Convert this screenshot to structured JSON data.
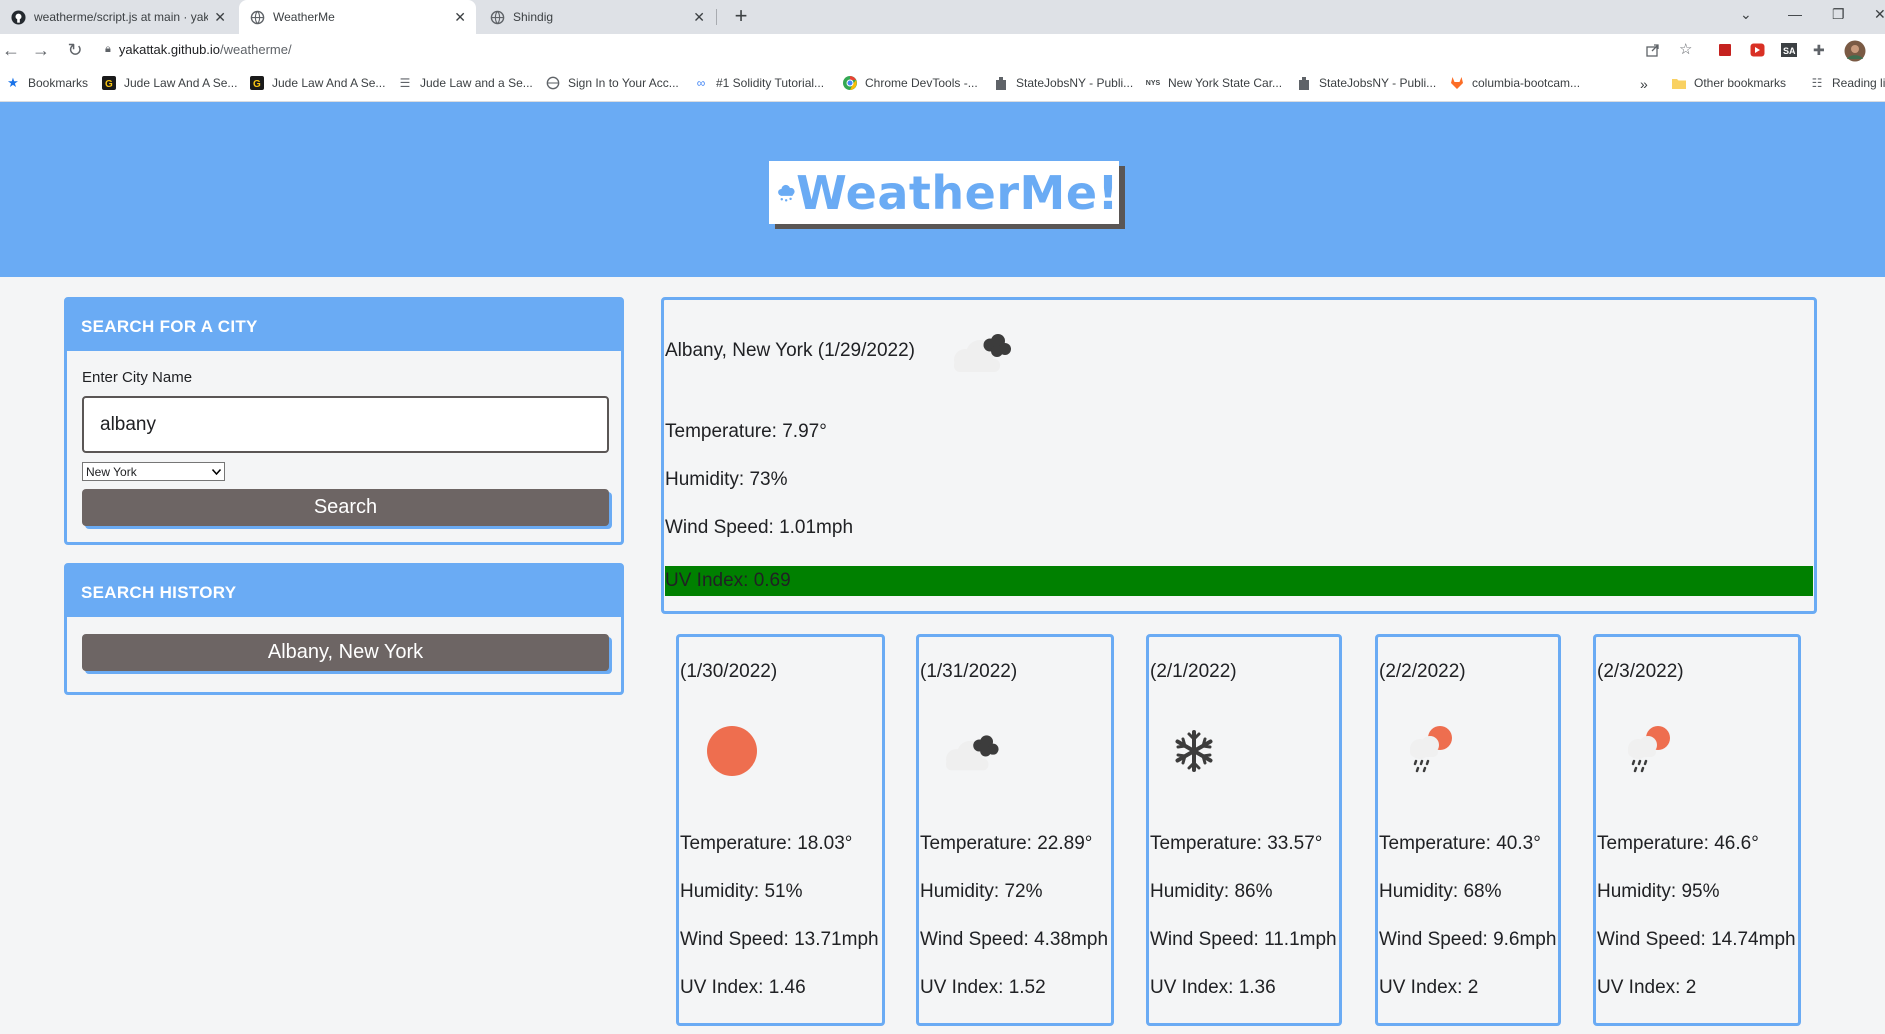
{
  "browser": {
    "tabs": [
      {
        "title": "weatherme/script.js at main · yak",
        "icon": "github-icon"
      },
      {
        "title": "WeatherMe",
        "icon": "globe-icon"
      },
      {
        "title": "Shindig",
        "icon": "globe-icon"
      }
    ],
    "url_host": "yakattak.github.io",
    "url_path": "/weatherme/",
    "bookmarks": [
      {
        "label": "Bookmarks",
        "icon": "star-icon"
      },
      {
        "label": "Jude Law And A Se...",
        "icon": "g-icon"
      },
      {
        "label": "Jude Law And A Se...",
        "icon": "g-icon"
      },
      {
        "label": "Jude Law and a Se...",
        "icon": "list-icon"
      },
      {
        "label": "Sign In to Your Acc...",
        "icon": "globe-icon"
      },
      {
        "label": "#1 Solidity Tutorial...",
        "icon": "link-icon"
      },
      {
        "label": "Chrome DevTools -...",
        "icon": "chrome-icon"
      },
      {
        "label": "StateJobsNY - Publi...",
        "icon": "building-icon"
      },
      {
        "label": "New York State Car...",
        "icon": "nys-icon"
      },
      {
        "label": "StateJobsNY - Publi...",
        "icon": "building-icon"
      },
      {
        "label": "columbia-bootcam...",
        "icon": "gitlab-icon"
      }
    ],
    "bookmarks_overflow": "»",
    "other_bookmarks": "Other bookmarks",
    "reading_list": "Reading li"
  },
  "app": {
    "logo_text": "WeatherMe!",
    "search": {
      "heading": "SEARCH FOR A CITY",
      "field_label": "Enter City Name",
      "city_value": "albany",
      "state_value": "New York",
      "button_label": "Search"
    },
    "history": {
      "heading": "SEARCH HISTORY",
      "items": [
        "Albany, New York"
      ]
    },
    "current": {
      "title": "Albany, New York (1/29/2022)",
      "icon": "cloudy-icon",
      "temperature": "Temperature: 7.97°",
      "humidity": "Humidity: 73%",
      "wind": "Wind Speed: 1.01mph",
      "uv": "UV Index: 0.69",
      "uv_color": "#008000"
    },
    "forecast": [
      {
        "date": "(1/30/2022)",
        "icon": "sun-icon",
        "temperature": "Temperature: 18.03°",
        "humidity": "Humidity: 51%",
        "wind": "Wind Speed: 13.71mph",
        "uv": "UV Index: 1.46"
      },
      {
        "date": "(1/31/2022)",
        "icon": "cloudy-icon",
        "temperature": "Temperature: 22.89°",
        "humidity": "Humidity: 72%",
        "wind": "Wind Speed: 4.38mph",
        "uv": "UV Index: 1.52"
      },
      {
        "date": "(2/1/2022)",
        "icon": "snowflake-icon",
        "temperature": "Temperature: 33.57°",
        "humidity": "Humidity: 86%",
        "wind": "Wind Speed: 11.1mph",
        "uv": "UV Index: 1.36"
      },
      {
        "date": "(2/2/2022)",
        "icon": "rain-sun-icon",
        "temperature": "Temperature: 40.3°",
        "humidity": "Humidity: 68%",
        "wind": "Wind Speed: 9.6mph",
        "uv": "UV Index: 2"
      },
      {
        "date": "(2/3/2022)",
        "icon": "rain-sun-icon",
        "temperature": "Temperature: 46.6°",
        "humidity": "Humidity: 95%",
        "wind": "Wind Speed: 14.74mph",
        "uv": "UV Index: 2"
      }
    ],
    "colors": {
      "brand": "#6aabf4",
      "button": "#6d6564",
      "sun": "#ee6e4f"
    }
  }
}
